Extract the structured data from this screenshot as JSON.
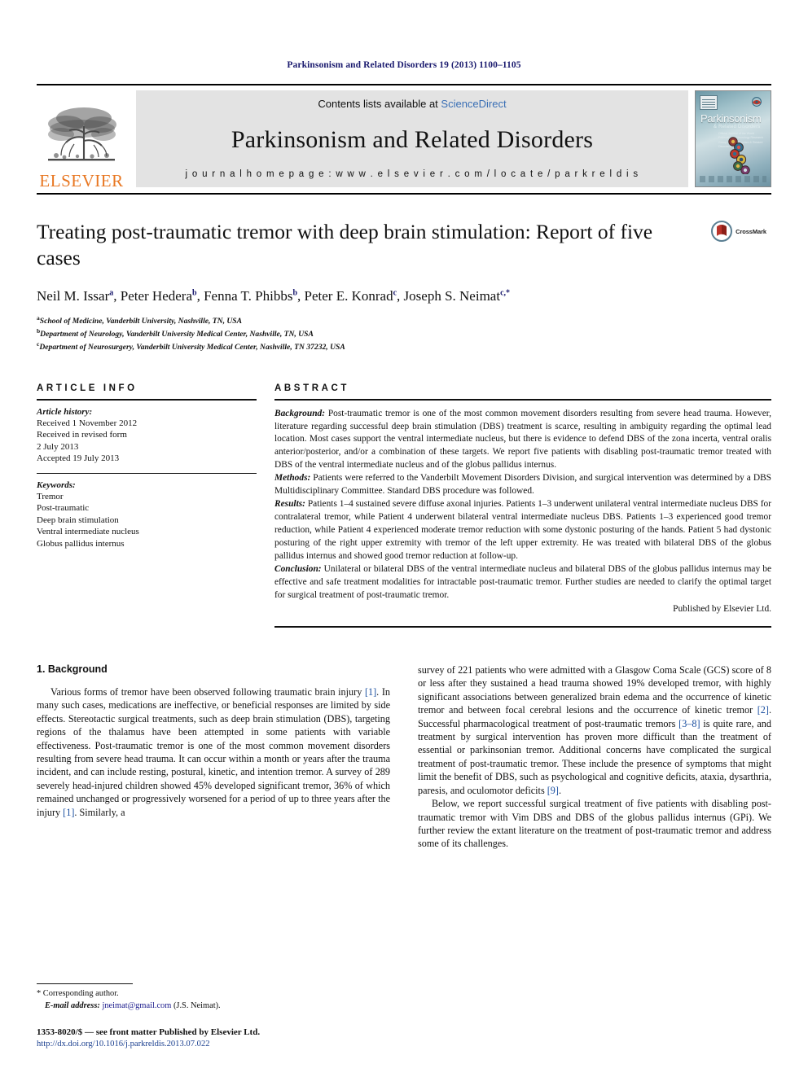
{
  "running_head": "Parkinsonism and Related Disorders 19 (2013) 1100–1105",
  "masthead": {
    "publisher_name": "ELSEVIER",
    "contents_prefix": "Contents lists available at ",
    "contents_link": "ScienceDirect",
    "journal_name": "Parkinsonism and Related Disorders",
    "homepage": "j o u r n a l   h o m e p a g e :   w w w . e l s e v i e r . c o m / l o c a t e / p a r k r e l d i s",
    "cover": {
      "title": "Parkinsonism",
      "subtitle": "& Related Disorders",
      "blurb": "Official Journal of the World Federation of Neurology Research Group on Parkinsonism & Related Disorders"
    }
  },
  "article": {
    "title": "Treating post-traumatic tremor with deep brain stimulation: Report of five cases",
    "crossmark_label": "CrossMark",
    "authors": [
      {
        "name": "Neil M. Issar",
        "marker": "a",
        "sep": ", "
      },
      {
        "name": "Peter Hedera",
        "marker": "b",
        "sep": ", "
      },
      {
        "name": "Fenna T. Phibbs",
        "marker": "b",
        "sep": ", "
      },
      {
        "name": "Peter E. Konrad",
        "marker": "c",
        "sep": ", "
      },
      {
        "name": "Joseph S. Neimat",
        "marker": "c,*",
        "sep": ""
      }
    ],
    "affiliations": [
      {
        "marker": "a",
        "text": "School of Medicine, Vanderbilt University, Nashville, TN, USA"
      },
      {
        "marker": "b",
        "text": "Department of Neurology, Vanderbilt University Medical Center, Nashville, TN, USA"
      },
      {
        "marker": "c",
        "text": "Department of Neurosurgery, Vanderbilt University Medical Center, Nashville, TN 37232, USA"
      }
    ]
  },
  "article_info": {
    "heading": "ARTICLE INFO",
    "history_label": "Article history:",
    "history_lines": [
      "Received 1 November 2012",
      "Received in revised form",
      "2 July 2013",
      "Accepted 19 July 2013"
    ],
    "keywords_label": "Keywords:",
    "keywords": [
      "Tremor",
      "Post-traumatic",
      "Deep brain stimulation",
      "Ventral intermediate nucleus",
      "Globus pallidus internus"
    ]
  },
  "abstract": {
    "heading": "ABSTRACT",
    "sections": [
      {
        "label": "Background:",
        "text": " Post-traumatic tremor is one of the most common movement disorders resulting from severe head trauma. However, literature regarding successful deep brain stimulation (DBS) treatment is scarce, resulting in ambiguity regarding the optimal lead location. Most cases support the ventral intermediate nucleus, but there is evidence to defend DBS of the zona incerta, ventral oralis anterior/posterior, and/or a combination of these targets. We report five patients with disabling post-traumatic tremor treated with DBS of the ventral intermediate nucleus and of the globus pallidus internus."
      },
      {
        "label": "Methods:",
        "text": " Patients were referred to the Vanderbilt Movement Disorders Division, and surgical intervention was determined by a DBS Multidisciplinary Committee. Standard DBS procedure was followed."
      },
      {
        "label": "Results:",
        "text": " Patients 1–4 sustained severe diffuse axonal injuries. Patients 1–3 underwent unilateral ventral intermediate nucleus DBS for contralateral tremor, while Patient 4 underwent bilateral ventral intermediate nucleus DBS. Patients 1–3 experienced good tremor reduction, while Patient 4 experienced moderate tremor reduction with some dystonic posturing of the hands. Patient 5 had dystonic posturing of the right upper extremity with tremor of the left upper extremity. He was treated with bilateral DBS of the globus pallidus internus and showed good tremor reduction at follow-up."
      },
      {
        "label": "Conclusion:",
        "text": " Unilateral or bilateral DBS of the ventral intermediate nucleus and bilateral DBS of the globus pallidus internus may be effective and safe treatment modalities for intractable post-traumatic tremor. Further studies are needed to clarify the optimal target for surgical treatment of post-traumatic tremor."
      }
    ],
    "signature": "Published by Elsevier Ltd."
  },
  "body": {
    "section_heading": "1. Background",
    "left_paragraph_1": "Various forms of tremor have been observed following traumatic brain injury ",
    "left_cite_1": "[1]",
    "left_paragraph_1b": ". In many such cases, medications are ineffective, or beneficial responses are limited by side effects. Stereotactic surgical treatments, such as deep brain stimulation (DBS), targeting regions of the thalamus have been attempted in some patients with variable effectiveness. Post-traumatic tremor is one of the most common movement disorders resulting from severe head trauma. It can occur within a month or years after the trauma incident, and can include resting, postural, kinetic, and intention tremor. A survey of 289 severely head-injured children showed 45% developed significant tremor, 36% of which remained unchanged or progressively worsened for a period of up to three years after the injury ",
    "left_cite_2": "[1]",
    "left_paragraph_1c": ". Similarly, a",
    "right_paragraph_1": "survey of 221 patients who were admitted with a Glasgow Coma Scale (GCS) score of 8 or less after they sustained a head trauma showed 19% developed tremor, with highly significant associations between generalized brain edema and the occurrence of kinetic tremor and between focal cerebral lesions and the occurrence of kinetic tremor ",
    "right_cite_1": "[2]",
    "right_paragraph_1b": ". Successful pharmacological treatment of post-traumatic tremors ",
    "right_cite_2": "[3–8]",
    "right_paragraph_1c": " is quite rare, and treatment by surgical intervention has proven more difficult than the treatment of essential or parkinsonian tremor. Additional concerns have complicated the surgical treatment of post-traumatic tremor. These include the presence of symptoms that might limit the benefit of DBS, such as psychological and cognitive deficits, ataxia, dysarthria, paresis, and oculomotor deficits ",
    "right_cite_3": "[9]",
    "right_paragraph_1d": ".",
    "right_paragraph_2": "Below, we report successful surgical treatment of five patients with disabling post-traumatic tremor with Vim DBS and DBS of the globus pallidus internus (GPi). We further review the extant literature on the treatment of post-traumatic tremor and address some of its challenges."
  },
  "footnotes": {
    "corresponding": "* Corresponding author.",
    "email_label": "E-mail address:",
    "email": "jneimat@gmail.com",
    "email_owner": " (J.S. Neimat).",
    "issn": "1353-8020/$ — see front matter Published by Elsevier Ltd.",
    "doi": "http://dx.doi.org/10.1016/j.parkreldis.2013.07.022"
  },
  "colors": {
    "elsevier_orange": "#E87722",
    "link_blue": "#3a6fb5",
    "citation_blue": "#1a4fa0",
    "running_head_navy": "#1a1a6e",
    "banner_grey": "#e3e3e3"
  }
}
